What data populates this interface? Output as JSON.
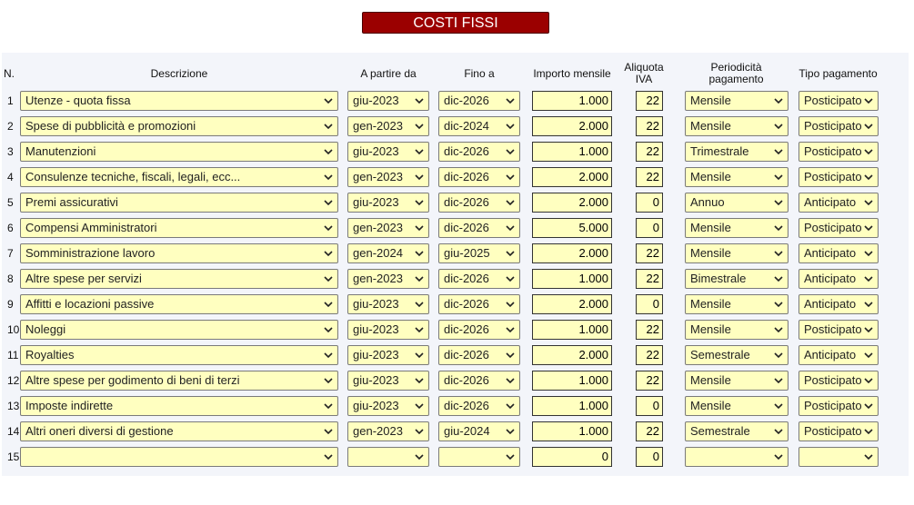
{
  "title": "COSTI FISSI",
  "headers": {
    "n": "N.",
    "descrizione": "Descrizione",
    "a_partire_da": "A partire da",
    "fino_a": "Fino a",
    "importo_mensile": "Importo mensile",
    "aliquota_line1": "Aliquota",
    "aliquota_line2": "IVA",
    "periodicita_line1": "Periodicità",
    "periodicita_line2": "pagamento",
    "tipo_pagamento": "Tipo pagamento"
  },
  "icons": {
    "dropdown": "chevron-down-icon"
  },
  "colors": {
    "title_bg": "#9b0000",
    "field_bg": "#ffffc0",
    "panel_bg": "#f3f5fa"
  },
  "rows": [
    {
      "n": "1",
      "desc": "Utenze - quota fissa",
      "from": "giu-2023",
      "to": "dic-2026",
      "amount": "1.000",
      "vat": "22",
      "period": "Mensile",
      "type": "Posticipato"
    },
    {
      "n": "2",
      "desc": "Spese di pubblicità e promozioni",
      "from": "gen-2023",
      "to": "dic-2024",
      "amount": "2.000",
      "vat": "22",
      "period": "Mensile",
      "type": "Posticipato"
    },
    {
      "n": "3",
      "desc": "Manutenzioni",
      "from": "giu-2023",
      "to": "dic-2026",
      "amount": "1.000",
      "vat": "22",
      "period": "Trimestrale",
      "type": "Posticipato"
    },
    {
      "n": "4",
      "desc": "Consulenze tecniche, fiscali, legali, ecc...",
      "from": "gen-2023",
      "to": "dic-2026",
      "amount": "2.000",
      "vat": "22",
      "period": "Mensile",
      "type": "Posticipato"
    },
    {
      "n": "5",
      "desc": "Premi assicurativi",
      "from": "giu-2023",
      "to": "dic-2026",
      "amount": "2.000",
      "vat": "0",
      "period": "Annuo",
      "type": "Anticipato"
    },
    {
      "n": "6",
      "desc": "Compensi Amministratori",
      "from": "gen-2023",
      "to": "dic-2026",
      "amount": "5.000",
      "vat": "0",
      "period": "Mensile",
      "type": "Posticipato"
    },
    {
      "n": "7",
      "desc": "Somministrazione lavoro",
      "from": "gen-2024",
      "to": "giu-2025",
      "amount": "2.000",
      "vat": "22",
      "period": "Mensile",
      "type": "Anticipato"
    },
    {
      "n": "8",
      "desc": "Altre spese per servizi",
      "from": "gen-2023",
      "to": "dic-2026",
      "amount": "1.000",
      "vat": "22",
      "period": "Bimestrale",
      "type": "Anticipato"
    },
    {
      "n": "9",
      "desc": "Affitti e locazioni passive",
      "from": "giu-2023",
      "to": "dic-2026",
      "amount": "2.000",
      "vat": "0",
      "period": "Mensile",
      "type": "Anticipato"
    },
    {
      "n": "10",
      "desc": "Noleggi",
      "from": "giu-2023",
      "to": "dic-2026",
      "amount": "1.000",
      "vat": "22",
      "period": "Mensile",
      "type": "Posticipato"
    },
    {
      "n": "11",
      "desc": "Royalties",
      "from": "giu-2023",
      "to": "dic-2026",
      "amount": "2.000",
      "vat": "22",
      "period": "Semestrale",
      "type": "Anticipato"
    },
    {
      "n": "12",
      "desc": "Altre spese per godimento di beni di terzi",
      "from": "giu-2023",
      "to": "dic-2026",
      "amount": "1.000",
      "vat": "22",
      "period": "Mensile",
      "type": "Posticipato"
    },
    {
      "n": "13",
      "desc": "Imposte indirette",
      "from": "giu-2023",
      "to": "dic-2026",
      "amount": "1.000",
      "vat": "0",
      "period": "Mensile",
      "type": "Posticipato"
    },
    {
      "n": "14",
      "desc": "Altri oneri diversi di gestione",
      "from": "gen-2023",
      "to": "giu-2024",
      "amount": "1.000",
      "vat": "22",
      "period": "Semestrale",
      "type": "Posticipato"
    },
    {
      "n": "15",
      "desc": "",
      "from": "",
      "to": "",
      "amount": "0",
      "vat": "0",
      "period": "",
      "type": ""
    }
  ]
}
